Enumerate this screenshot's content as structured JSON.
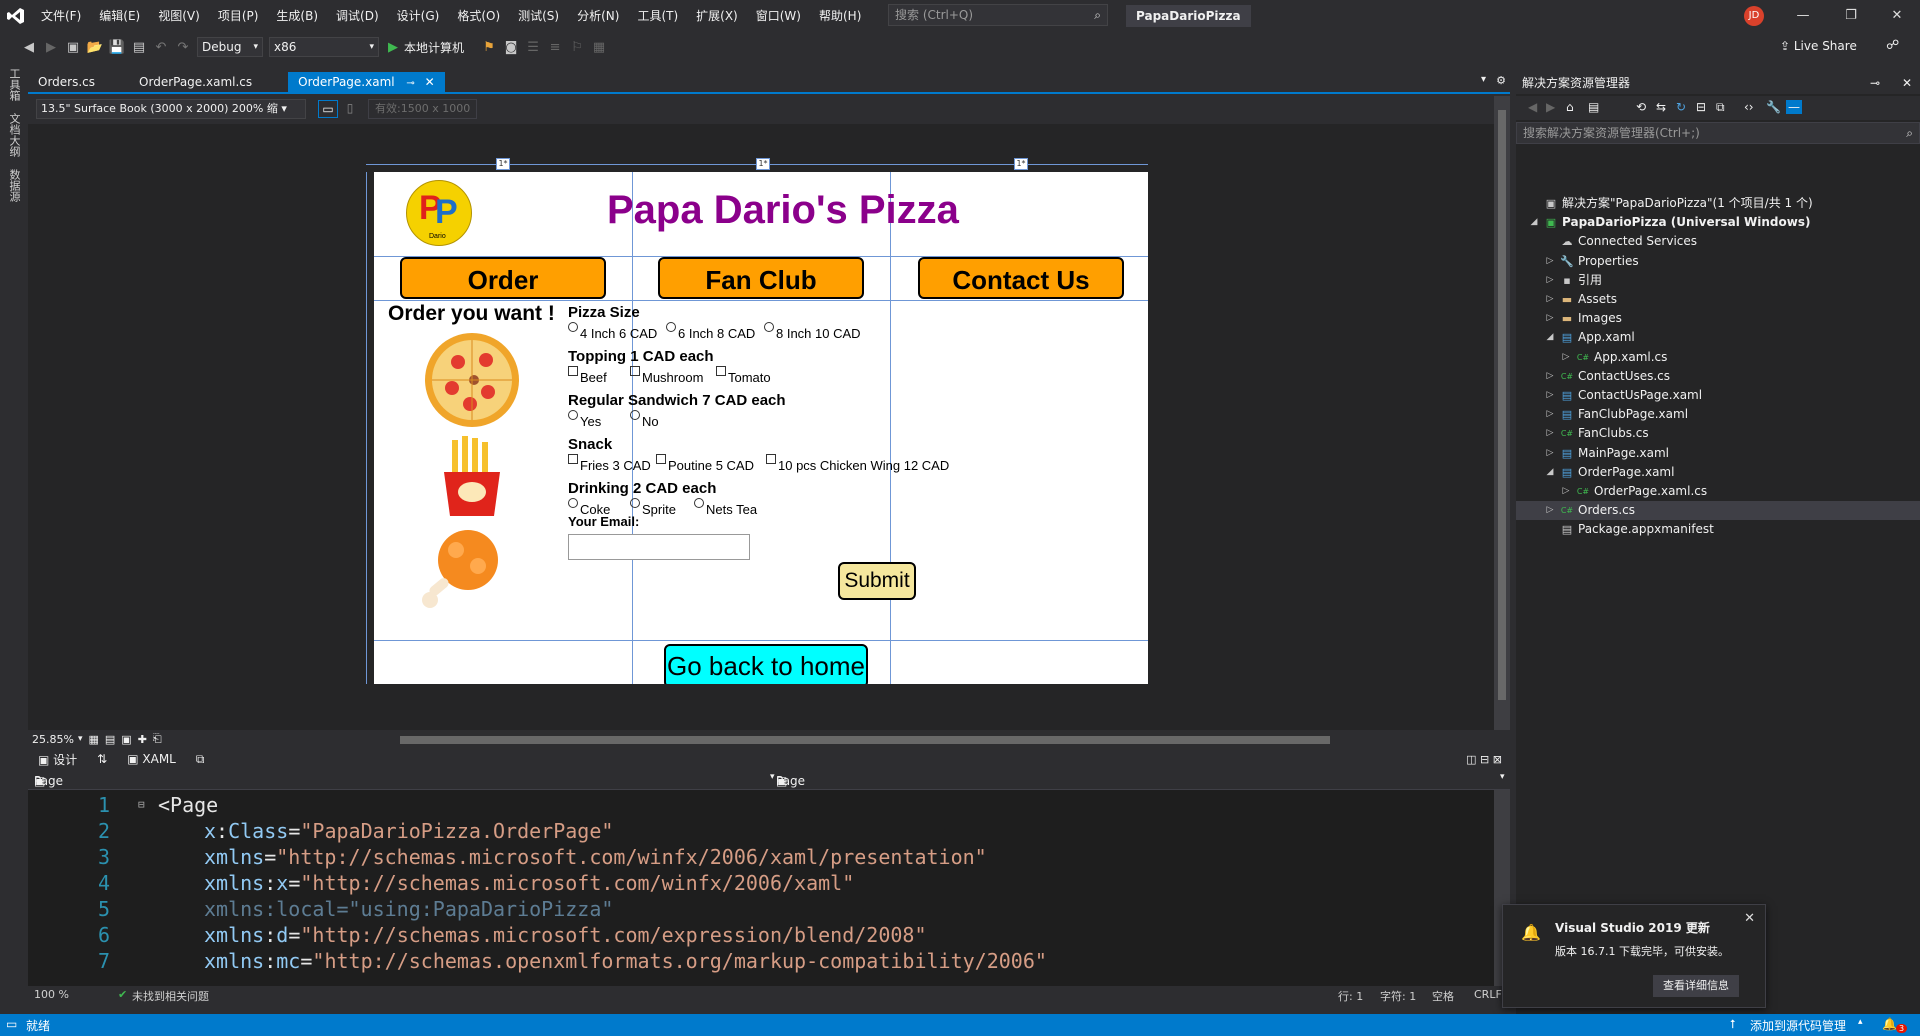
{
  "menubar": {
    "items": [
      "文件(F)",
      "编辑(E)",
      "视图(V)",
      "项目(P)",
      "生成(B)",
      "调试(D)",
      "设计(G)",
      "格式(O)",
      "测试(S)",
      "分析(N)",
      "工具(T)",
      "扩展(X)",
      "窗口(W)",
      "帮助(H)"
    ],
    "search_placeholder": "搜索 (Ctrl+Q)",
    "solution_name": "PapaDarioPizza",
    "user_initials": "JD"
  },
  "toolbar": {
    "config": "Debug",
    "platform": "x86",
    "run_label": "本地计算机",
    "live_share": "Live Share"
  },
  "left_strip": [
    "工具箱",
    "文档大纲",
    "数据源"
  ],
  "doc_tabs": [
    {
      "label": "Orders.cs",
      "active": false
    },
    {
      "label": "OrderPage.xaml.cs",
      "active": false
    },
    {
      "label": "OrderPage.xaml",
      "active": true
    }
  ],
  "designer": {
    "device": "13.5\" Surface Book (3000 x 2000) 200% 缩",
    "effective_size": "有效:1500 x 1000",
    "zoom": "25.85%",
    "design_tab": "设计",
    "xaml_tab": "XAML",
    "nav_left": "Page",
    "nav_right": "Page"
  },
  "app": {
    "title": "Papa Dario's Pizza",
    "logo_text": "Dario",
    "nav": [
      "Order",
      "Fan Club",
      "Contact Us"
    ],
    "order_heading": "Order you want !",
    "pizza_size_label": "Pizza Size",
    "pizza_sizes": [
      "4 Inch 6 CAD",
      "6 Inch 8 CAD",
      "8 Inch 10 CAD"
    ],
    "topping_label": "Topping 1 CAD each",
    "toppings": [
      "Beef",
      "Mushroom",
      "Tomato"
    ],
    "sandwich_label": "Regular Sandwich 7 CAD each",
    "sandwich": [
      "Yes",
      "No"
    ],
    "snack_label": "Snack",
    "snacks": [
      "Fries 3 CAD",
      "Poutine 5 CAD",
      "10 pcs Chicken Wing 12 CAD"
    ],
    "drinking_label": "Drinking 2 CAD each",
    "drinks": [
      "Coke",
      "Sprite",
      "Nets Tea"
    ],
    "email_label": "Your Email:",
    "submit": "Submit",
    "home": "Go back to home",
    "grid_marks": [
      "1*",
      "1*",
      "1*"
    ]
  },
  "code": {
    "lines": [
      {
        "n": "1",
        "parts": [
          {
            "t": "<",
            "c": "tag"
          },
          {
            "t": "Page",
            "c": "tag"
          }
        ]
      },
      {
        "n": "2",
        "parts": [
          {
            "t": "x",
            "c": "attr"
          },
          {
            "t": ":",
            "c": "tag"
          },
          {
            "t": "Class",
            "c": "attr"
          },
          {
            "t": "=",
            "c": "tag"
          },
          {
            "t": "\"PapaDarioPizza.OrderPage\"",
            "c": "val"
          }
        ]
      },
      {
        "n": "3",
        "parts": [
          {
            "t": "xmlns",
            "c": "attr"
          },
          {
            "t": "=",
            "c": "tag"
          },
          {
            "t": "\"http://schemas.microsoft.com/winfx/2006/xaml/presentation\"",
            "c": "val"
          }
        ]
      },
      {
        "n": "4",
        "parts": [
          {
            "t": "xmlns",
            "c": "attr"
          },
          {
            "t": ":",
            "c": "tag"
          },
          {
            "t": "x",
            "c": "attr"
          },
          {
            "t": "=",
            "c": "tag"
          },
          {
            "t": "\"http://schemas.microsoft.com/winfx/2006/xaml\"",
            "c": "val"
          }
        ]
      },
      {
        "n": "5",
        "parts": [
          {
            "t": "xmlns:local=\"using:PapaDarioPizza\"",
            "c": "attr dim"
          }
        ]
      },
      {
        "n": "6",
        "parts": [
          {
            "t": "xmlns",
            "c": "attr"
          },
          {
            "t": ":",
            "c": "tag"
          },
          {
            "t": "d",
            "c": "attr"
          },
          {
            "t": "=",
            "c": "tag"
          },
          {
            "t": "\"http://schemas.microsoft.com/expression/blend/2008\"",
            "c": "val"
          }
        ]
      },
      {
        "n": "7",
        "parts": [
          {
            "t": "xmlns",
            "c": "attr"
          },
          {
            "t": ":",
            "c": "tag"
          },
          {
            "t": "mc",
            "c": "attr"
          },
          {
            "t": "=",
            "c": "tag"
          },
          {
            "t": "\"http://schemas.openxmlformats.org/markup-compatibility/2006\"",
            "c": "val"
          }
        ]
      }
    ],
    "zoom": "100 %",
    "issues": "未找到相关问题",
    "row": "行: 1",
    "col": "字符: 1",
    "ws": "空格",
    "eol": "CRLF"
  },
  "solution_explorer": {
    "title": "解决方案资源管理器",
    "search_placeholder": "搜索解决方案资源管理器(Ctrl+;)",
    "items": [
      {
        "label": "解决方案\"PapaDarioPizza\"(1 个项目/共 1 个)",
        "level": 0,
        "exp": "",
        "icon": "solution-icon",
        "bold": false
      },
      {
        "label": "PapaDarioPizza (Universal Windows)",
        "level": 0,
        "exp": "◢",
        "icon": "project-icon",
        "bold": true
      },
      {
        "label": "Connected Services",
        "level": 1,
        "exp": "",
        "icon": "connected-icon",
        "bold": false
      },
      {
        "label": "Properties",
        "level": 1,
        "exp": "▷",
        "icon": "wrench-icon",
        "bold": false
      },
      {
        "label": "引用",
        "level": 1,
        "exp": "▷",
        "icon": "references-icon",
        "bold": false
      },
      {
        "label": "Assets",
        "level": 1,
        "exp": "▷",
        "icon": "folder-icon",
        "bold": false
      },
      {
        "label": "Images",
        "level": 1,
        "exp": "▷",
        "icon": "folder-icon",
        "bold": false
      },
      {
        "label": "App.xaml",
        "level": 1,
        "exp": "◢",
        "icon": "xaml-icon",
        "bold": false
      },
      {
        "label": "App.xaml.cs",
        "level": 2,
        "exp": "▷",
        "icon": "cs-icon",
        "bold": false
      },
      {
        "label": "ContactUses.cs",
        "level": 1,
        "exp": "▷",
        "icon": "cs-icon",
        "bold": false
      },
      {
        "label": "ContactUsPage.xaml",
        "level": 1,
        "exp": "▷",
        "icon": "xaml-icon",
        "bold": false
      },
      {
        "label": "FanClubPage.xaml",
        "level": 1,
        "exp": "▷",
        "icon": "xaml-icon",
        "bold": false
      },
      {
        "label": "FanClubs.cs",
        "level": 1,
        "exp": "▷",
        "icon": "cs-icon",
        "bold": false
      },
      {
        "label": "MainPage.xaml",
        "level": 1,
        "exp": "▷",
        "icon": "xaml-icon",
        "bold": false
      },
      {
        "label": "OrderPage.xaml",
        "level": 1,
        "exp": "◢",
        "icon": "xaml-icon",
        "bold": false
      },
      {
        "label": "OrderPage.xaml.cs",
        "level": 2,
        "exp": "▷",
        "icon": "cs-icon",
        "bold": false
      },
      {
        "label": "Orders.cs",
        "level": 1,
        "exp": "▷",
        "icon": "cs-icon",
        "bold": false,
        "selected": true
      },
      {
        "label": "Package.appxmanifest",
        "level": 1,
        "exp": "",
        "icon": "manifest-icon",
        "bold": false
      }
    ]
  },
  "notification": {
    "title": "Visual Studio 2019 更新",
    "body": "版本 16.7.1 下载完毕，可供安装。",
    "button": "查看详细信息"
  },
  "statusbar": {
    "ready": "就绪",
    "source_control": "添加到源代码管理",
    "badge": "3"
  },
  "colors": {
    "accent": "#007acc",
    "title_purple": "#8b008b",
    "nav_orange": "#ff9f00",
    "home_cyan": "#00ffff"
  }
}
